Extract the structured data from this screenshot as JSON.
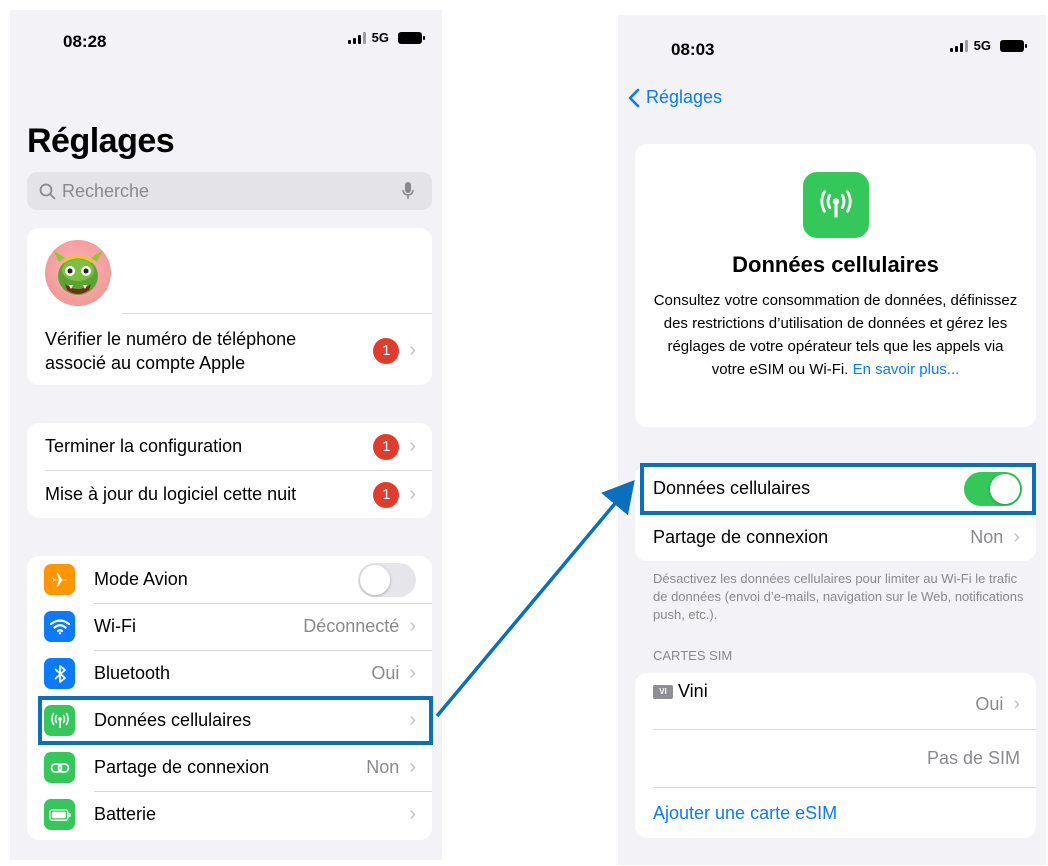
{
  "left_screen": {
    "status": {
      "time": "08:28",
      "network": "5G"
    },
    "title": "Réglages",
    "search": {
      "placeholder": "Recherche"
    },
    "account_card": {
      "verify_label": "Vérifier le numéro de téléphone associé au compte Apple",
      "verify_badge": "1"
    },
    "todo_group": [
      {
        "label": "Terminer la configuration",
        "badge": "1"
      },
      {
        "label": "Mise à jour du logiciel cette nuit",
        "badge": "1"
      }
    ],
    "settings": [
      {
        "label": "Mode Avion",
        "value": "",
        "icon": "airplane-icon",
        "color": "#ff9500",
        "toggle": "off"
      },
      {
        "label": "Wi-Fi",
        "value": "Déconnecté",
        "icon": "wifi-icon",
        "color": "#0a7aff"
      },
      {
        "label": "Bluetooth",
        "value": "Oui",
        "icon": "bluetooth-icon",
        "color": "#0a7aff"
      },
      {
        "label": "Données cellulaires",
        "value": "",
        "icon": "antenna-icon",
        "color": "#34c759",
        "highlighted": true
      },
      {
        "label": "Partage de connexion",
        "value": "Non",
        "icon": "hotspot-icon",
        "color": "#34c759"
      },
      {
        "label": "Batterie",
        "value": "",
        "icon": "battery-icon",
        "color": "#34c759"
      }
    ]
  },
  "right_screen": {
    "status": {
      "time": "08:03",
      "network": "5G"
    },
    "back_label": "Réglages",
    "info": {
      "title": "Données cellulaires",
      "description": "Consultez votre consommation de données, définissez des restrictions d’utilisation de données et gérez les réglages de votre opérateur tels que les appels via votre eSIM ou Wi-Fi.",
      "link": "En savoir plus..."
    },
    "cellular_toggle_label": "Données cellulaires",
    "cellular_toggle_state": "on",
    "hotspot": {
      "label": "Partage de connexion",
      "value": "Non"
    },
    "footnote": "Désactivez les données cellulaires pour limiter au Wi-Fi le trafic de données (envoi d’e-mails, navigation sur le Web, notifications push, etc.).",
    "sim_section_header": "CARTES SIM",
    "sim": {
      "chip": "VI",
      "name": "Vini",
      "value": "Oui"
    },
    "no_sim": "Pas de SIM",
    "add_esim": "Ajouter une carte eSIM"
  },
  "colors": {
    "accent_blue": "#0a7aff",
    "highlight_blue": "#0b6fbf",
    "green": "#34c759",
    "badge_red": "#e23b2e",
    "orange": "#ff9500"
  }
}
